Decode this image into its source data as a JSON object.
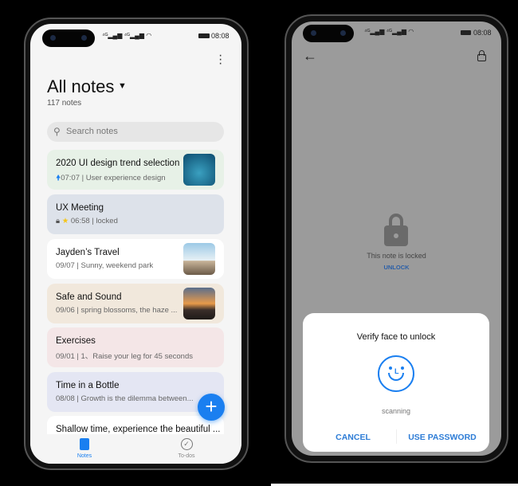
{
  "status": {
    "time": "08:08",
    "signal": "4G signal",
    "wifi": "wifi-icon",
    "battery": "battery-icon"
  },
  "notes_screen": {
    "title": "All notes",
    "count": "117 notes",
    "search_placeholder": "Search notes",
    "notes": [
      {
        "title": "2020 UI design trend selection",
        "time": "07:07",
        "sub": " | User experience design",
        "color": "#e7f1e7",
        "pinned": true
      },
      {
        "title": "UX Meeting",
        "time": "06:58",
        "sub": " | locked",
        "color": "#dde2ea",
        "locked": true,
        "starred": true
      },
      {
        "title": "Jayden’s Travel",
        "sub": "09/07 | Sunny, weekend park",
        "color": "#ffffff"
      },
      {
        "title": "Safe and Sound",
        "sub": "09/06 | spring blossoms, the haze ...",
        "color": "#f1e8dc"
      },
      {
        "title": "Exercises",
        "sub": "09/01 | 1、Raise your leg for 45 seconds",
        "color": "#f4e6e7"
      },
      {
        "title": "Time in a Bottle",
        "sub": "08/08 | Growth is the dilemma between...",
        "color": "#e4e6f3"
      },
      {
        "title": "Shallow time, experience the beautiful ...",
        "color": "#ffffff"
      }
    ],
    "nav": {
      "notes": "Notes",
      "todos": "To-dos"
    },
    "accent": "#1a7ff0"
  },
  "locked_screen": {
    "message": "This note is locked",
    "unlock": "UNLOCK",
    "dialog": {
      "title": "Verify face to unlock",
      "status": "scanning",
      "cancel": "CANCEL",
      "use_password": "USE PASSWORD"
    }
  }
}
